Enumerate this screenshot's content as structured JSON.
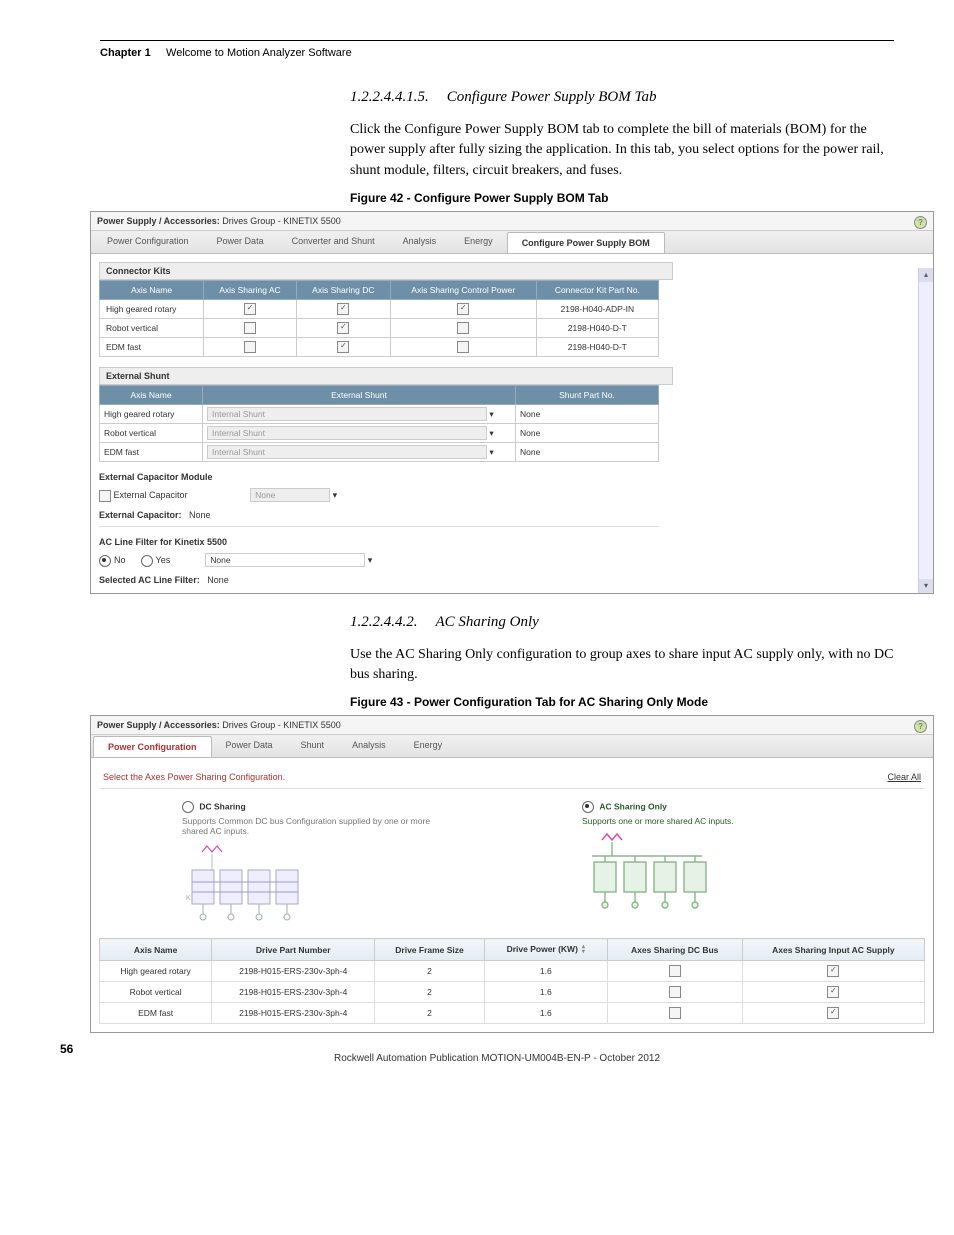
{
  "chapter": {
    "label": "Chapter 1",
    "title": "Welcome to Motion Analyzer Software"
  },
  "sec1": {
    "num": "1.2.2.4.4.1.5.",
    "title": "Configure Power Supply BOM Tab"
  },
  "para1": "Click the Configure Power Supply BOM tab to complete the bill of materials (BOM) for the power supply after fully sizing the application. In this tab, you select options for the power rail, shunt module, filters, circuit breakers, and fuses.",
  "fig1": "Figure 42 - Configure Power Supply BOM Tab",
  "ss1": {
    "breadcrumb_label": "Power Supply / Accessories:",
    "breadcrumb_value": "Drives Group - KINETIX 5500",
    "tabs": [
      "Power Configuration",
      "Power Data",
      "Converter and Shunt",
      "Analysis",
      "Energy",
      "Configure Power Supply BOM"
    ],
    "conn_header": "Connector Kits",
    "conn_cols": [
      "Axis Name",
      "Axis Sharing AC",
      "Axis Sharing DC",
      "Axis Sharing Control Power",
      "Connector Kit Part No."
    ],
    "conn_rows": [
      {
        "name": "High geared rotary",
        "ac": true,
        "dc": true,
        "cp": true,
        "part": "2198-H040-ADP-IN"
      },
      {
        "name": "Robot vertical",
        "ac": false,
        "dc": true,
        "cp": false,
        "part": "2198-H040-D-T"
      },
      {
        "name": "EDM fast",
        "ac": false,
        "dc": true,
        "cp": false,
        "part": "2198-H040-D-T"
      }
    ],
    "ext_shunt_header": "External Shunt",
    "ext_shunt_cols": [
      "Axis Name",
      "External Shunt",
      "Shunt Part No."
    ],
    "ext_shunt_rows": [
      {
        "name": "High geared rotary",
        "sel": "Internal Shunt",
        "part": "None"
      },
      {
        "name": "Robot vertical",
        "sel": "Internal Shunt",
        "part": "None"
      },
      {
        "name": "EDM fast",
        "sel": "Internal Shunt",
        "part": "None"
      }
    ],
    "ext_cap_header": "External Capacitor Module",
    "ext_cap_chk_label": "External Capacitor",
    "ext_cap_none": "None",
    "ext_cap_value_label": "External Capacitor:",
    "ext_cap_value": "None",
    "filter_header": "AC Line Filter for Kinetix 5500",
    "radio_no": "No",
    "radio_yes": "Yes",
    "filter_drop": "None",
    "filter_value_label": "Selected AC Line Filter:",
    "filter_value": "None"
  },
  "sec2": {
    "num": "1.2.2.4.4.2.",
    "title": "AC Sharing Only"
  },
  "para2": "Use the AC Sharing Only configuration to group axes to share input AC supply only, with no DC bus sharing.",
  "fig2": "Figure 43 - Power Configuration Tab for AC Sharing Only Mode",
  "ss2": {
    "breadcrumb_label": "Power Supply / Accessories:",
    "breadcrumb_value": "Drives Group - KINETIX 5500",
    "tabs": [
      "Power Configuration",
      "Power Data",
      "Shunt",
      "Analysis",
      "Energy"
    ],
    "select_label": "Select the Axes Power Sharing Configuration.",
    "clear": "Clear All",
    "dc_title": "DC Sharing",
    "dc_desc": "Supports Common DC bus Configuration supplied by one or more shared AC inputs.",
    "ac_title": "AC Sharing Only",
    "ac_desc": "Supports one or more shared AC inputs.",
    "cols": [
      "Axis Name",
      "Drive Part Number",
      "Drive Frame Size",
      "Drive Power (KW)",
      "Axes Sharing DC Bus",
      "Axes Sharing Input AC Supply"
    ],
    "rows": [
      {
        "name": "High geared rotary",
        "part": "2198-H015-ERS-230v-3ph-4",
        "frame": "2",
        "power": "1.6",
        "dc": false,
        "ac": true
      },
      {
        "name": "Robot vertical",
        "part": "2198-H015-ERS-230v-3ph-4",
        "frame": "2",
        "power": "1.6",
        "dc": false,
        "ac": true
      },
      {
        "name": "EDM fast",
        "part": "2198-H015-ERS-230v-3ph-4",
        "frame": "2",
        "power": "1.6",
        "dc": false,
        "ac": true
      }
    ]
  },
  "footer": "Rockwell Automation Publication MOTION-UM004B-EN-P - October 2012",
  "page": "56"
}
